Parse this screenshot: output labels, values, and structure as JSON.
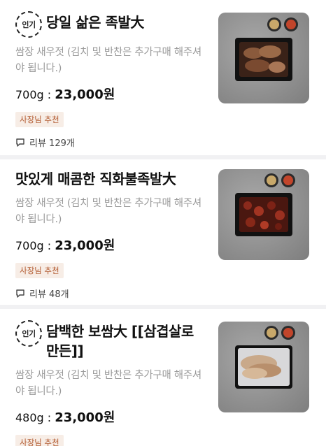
{
  "items": [
    {
      "badge": "인기",
      "title": "당일 삶은 족발大",
      "description": "쌈장 새우젓 (김치 및 반찬은 추가구매 해주셔야 됩니다.)",
      "weight": "700g : ",
      "price": "23,000원",
      "tag": "사장님 추천",
      "review": "리뷰 129개"
    },
    {
      "badge": "",
      "title": "맛있게 매콤한 직화불족발大",
      "description": "쌈장 새우젓 (김치 및 반찬은 추가구매 해주셔야 됩니다.)",
      "weight": "700g : ",
      "price": "23,000원",
      "tag": "사장님 추천",
      "review": "리뷰 48개"
    },
    {
      "badge": "인기",
      "title": "담백한 보쌈大 [[삼겹살로만든]]",
      "description": "쌈장 새우젓 (김치 및 반찬은 추가구매 해주셔야 됩니다.)",
      "weight": "480g : ",
      "price": "23,000원",
      "tag": "사장님 추천"
    }
  ]
}
